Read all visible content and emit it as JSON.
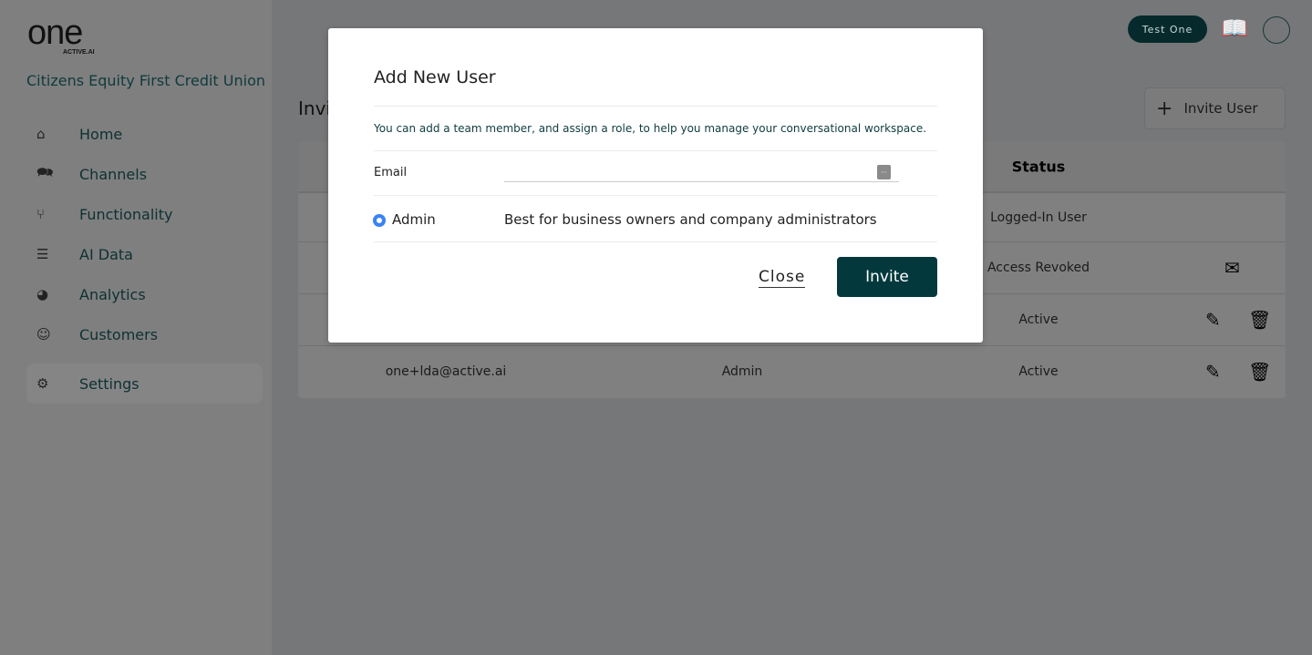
{
  "brand": {
    "logo": "one",
    "logo_sub": "ACTIVE.AI",
    "org": "Citizens Equity First Credit Union"
  },
  "sidebar": {
    "items": [
      {
        "label": "Home",
        "icon": "home-icon",
        "glyph": "⌂"
      },
      {
        "label": "Channels",
        "icon": "chat-icon",
        "glyph": "🗪"
      },
      {
        "label": "Functionality",
        "icon": "flow-icon",
        "glyph": "⑂"
      },
      {
        "label": "AI Data",
        "icon": "database-icon",
        "glyph": "☰"
      },
      {
        "label": "Analytics",
        "icon": "pie-chart-icon",
        "glyph": "◕"
      },
      {
        "label": "Customers",
        "icon": "smiley-icon",
        "glyph": "☺"
      },
      {
        "label": "Settings",
        "icon": "gear-icon",
        "glyph": "⚙",
        "active": true
      }
    ]
  },
  "topbar": {
    "user": "Test One"
  },
  "main": {
    "title": "Invi",
    "invite_button": "Invite User",
    "table": {
      "headers": {
        "status": "Status"
      },
      "rows": [
        {
          "email": "",
          "role": "",
          "status": "Logged-In User"
        },
        {
          "email": "",
          "role": "",
          "status": "Access Revoked"
        },
        {
          "email": "",
          "role": "",
          "status": "Active"
        },
        {
          "email": "one+lda@active.ai",
          "role": "Admin",
          "status": "Active"
        }
      ]
    }
  },
  "modal": {
    "title": "Add New User",
    "description": "You can add a team member, and assign a role, to help you manage your conversational workspace.",
    "email_label": "Email",
    "email_value": "",
    "role": "Admin",
    "role_description": "Best for business owners and company administrators",
    "role_selected": true,
    "close": "Close",
    "invite": "Invite"
  },
  "colors": {
    "primary": "#03393d",
    "radio": "#3b82f6"
  }
}
